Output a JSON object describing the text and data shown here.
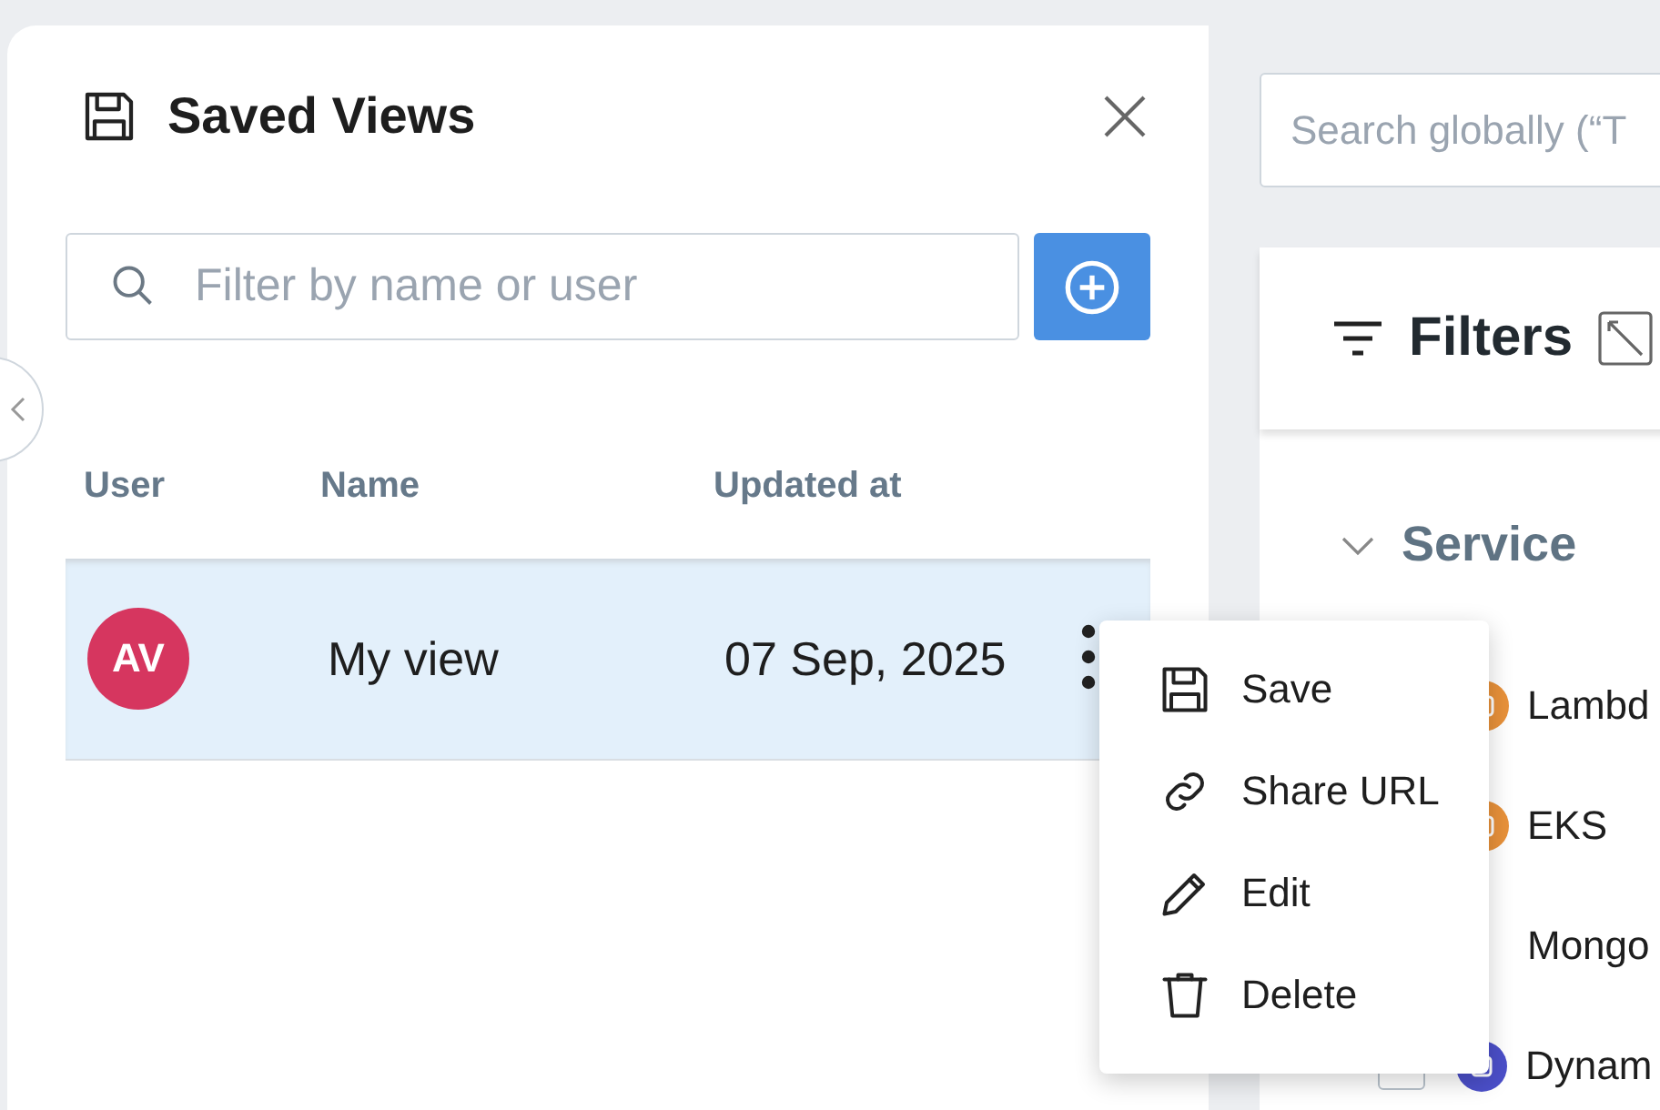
{
  "saved_views": {
    "title": "Saved Views",
    "filter": {
      "placeholder": "Filter by name or user"
    },
    "columns": [
      "User",
      "Name",
      "Updated at"
    ],
    "rows": [
      {
        "initials": "AV",
        "name": "My view",
        "updated": "07 Sep, 2025",
        "selected": true
      }
    ]
  },
  "context_menu": [
    {
      "kind": "save",
      "label": "Save"
    },
    {
      "kind": "link",
      "label": "Share URL"
    },
    {
      "kind": "edit",
      "label": "Edit"
    },
    {
      "kind": "delete",
      "label": "Delete"
    }
  ],
  "global_search": {
    "placeholder": "Search globally (“T"
  },
  "filters": {
    "title": "Filters",
    "groups": [
      {
        "label": "Service",
        "expanded": true,
        "items": [
          {
            "label": "Lambd",
            "color": "#e8913a"
          },
          {
            "label": "EKS",
            "color": "#e8913a"
          },
          {
            "label": "Mongo"
          },
          {
            "label": "Dynam",
            "color": "#4b4fc9",
            "checked": false
          }
        ]
      }
    ]
  }
}
